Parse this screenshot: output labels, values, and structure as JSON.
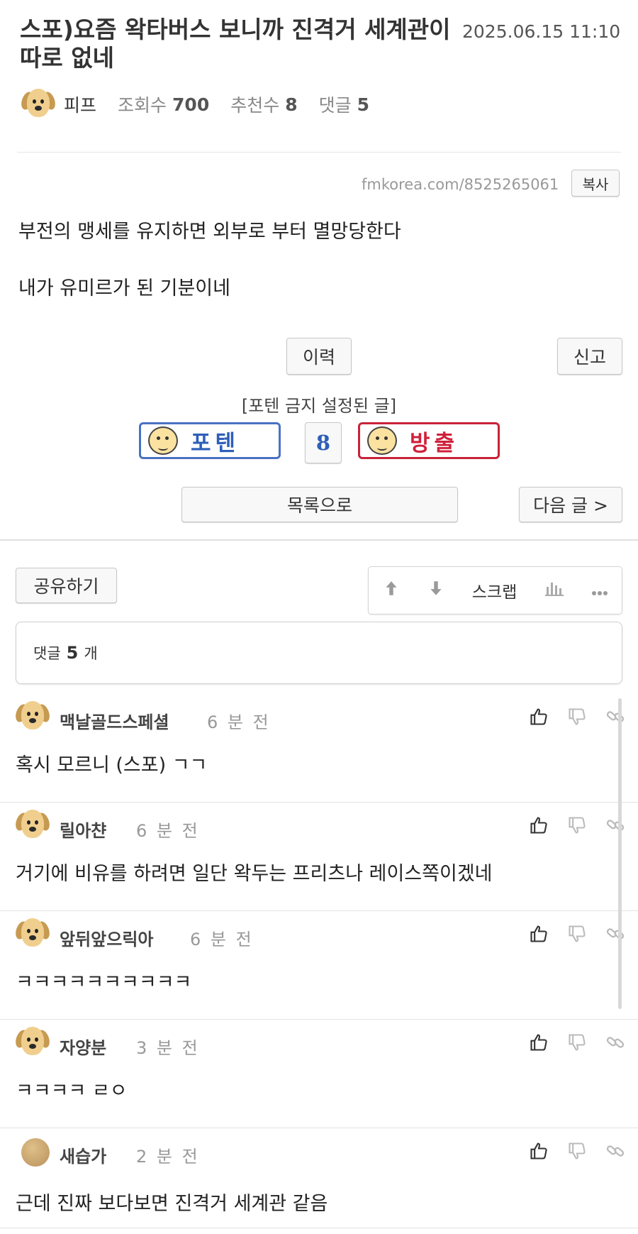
{
  "post": {
    "title": "스포)요즘 왁타버스 보니까 진격거 세계관이 따로 없네",
    "date": "2025.06.15 11:10",
    "author": "피프",
    "views_label": "조회수",
    "views": "700",
    "recommend_label": "추천수",
    "recommends": "8",
    "comments_label": "댓글",
    "comments": "5",
    "url": "fmkorea.com/8525265061",
    "copy_label": "복사",
    "body_line1": "부전의 맹세를 유지하면 외부로 부터 멸망당한다",
    "body_line2": "내가 유미르가 된 기분이네"
  },
  "buttons": {
    "history": "이력",
    "report": "신고",
    "poten_note": "[포텐 금지 설정된 글]",
    "poten": "포텐",
    "vote_count": "8",
    "bangchul": "방출",
    "list": "목록으로",
    "next": "다음 글 >",
    "share": "공유하기",
    "scrap": "스크랩"
  },
  "comment_box": {
    "label": "댓글",
    "count": "5",
    "unit": "개"
  },
  "comments": [
    {
      "name": "맥날골드스페셜",
      "time": "6 분 전",
      "text": "혹시 모르니 (스포) ㄱㄱ"
    },
    {
      "name": "릴아챤",
      "time": "6 분 전",
      "text": "거기에 비유를 하려면 일단 왁두는 프리츠나 레이스쪽이겠네"
    },
    {
      "name": "앞뒤앞으릭아",
      "time": "6 분 전",
      "text": "ㅋㅋㅋㅋㅋㅋㅋㅋㅋㅋ"
    },
    {
      "name": "자양분",
      "time": "3 분 전",
      "text": "ㅋㅋㅋㅋ ㄹㅇ"
    },
    {
      "name": "새습가",
      "time": "2 분 전",
      "text": "근데 진짜 보다보면 진격거 세계관 같음"
    }
  ],
  "icons": {
    "upvote": "arrow-up-icon",
    "downvote": "arrow-down-icon",
    "stats": "bar-chart-icon",
    "more": "more-icon",
    "like": "thumbs-up-icon",
    "dislike": "thumbs-down-icon",
    "link": "link-icon"
  },
  "colors": {
    "poten": "#2e5fb8",
    "bangchul": "#d0203a"
  }
}
